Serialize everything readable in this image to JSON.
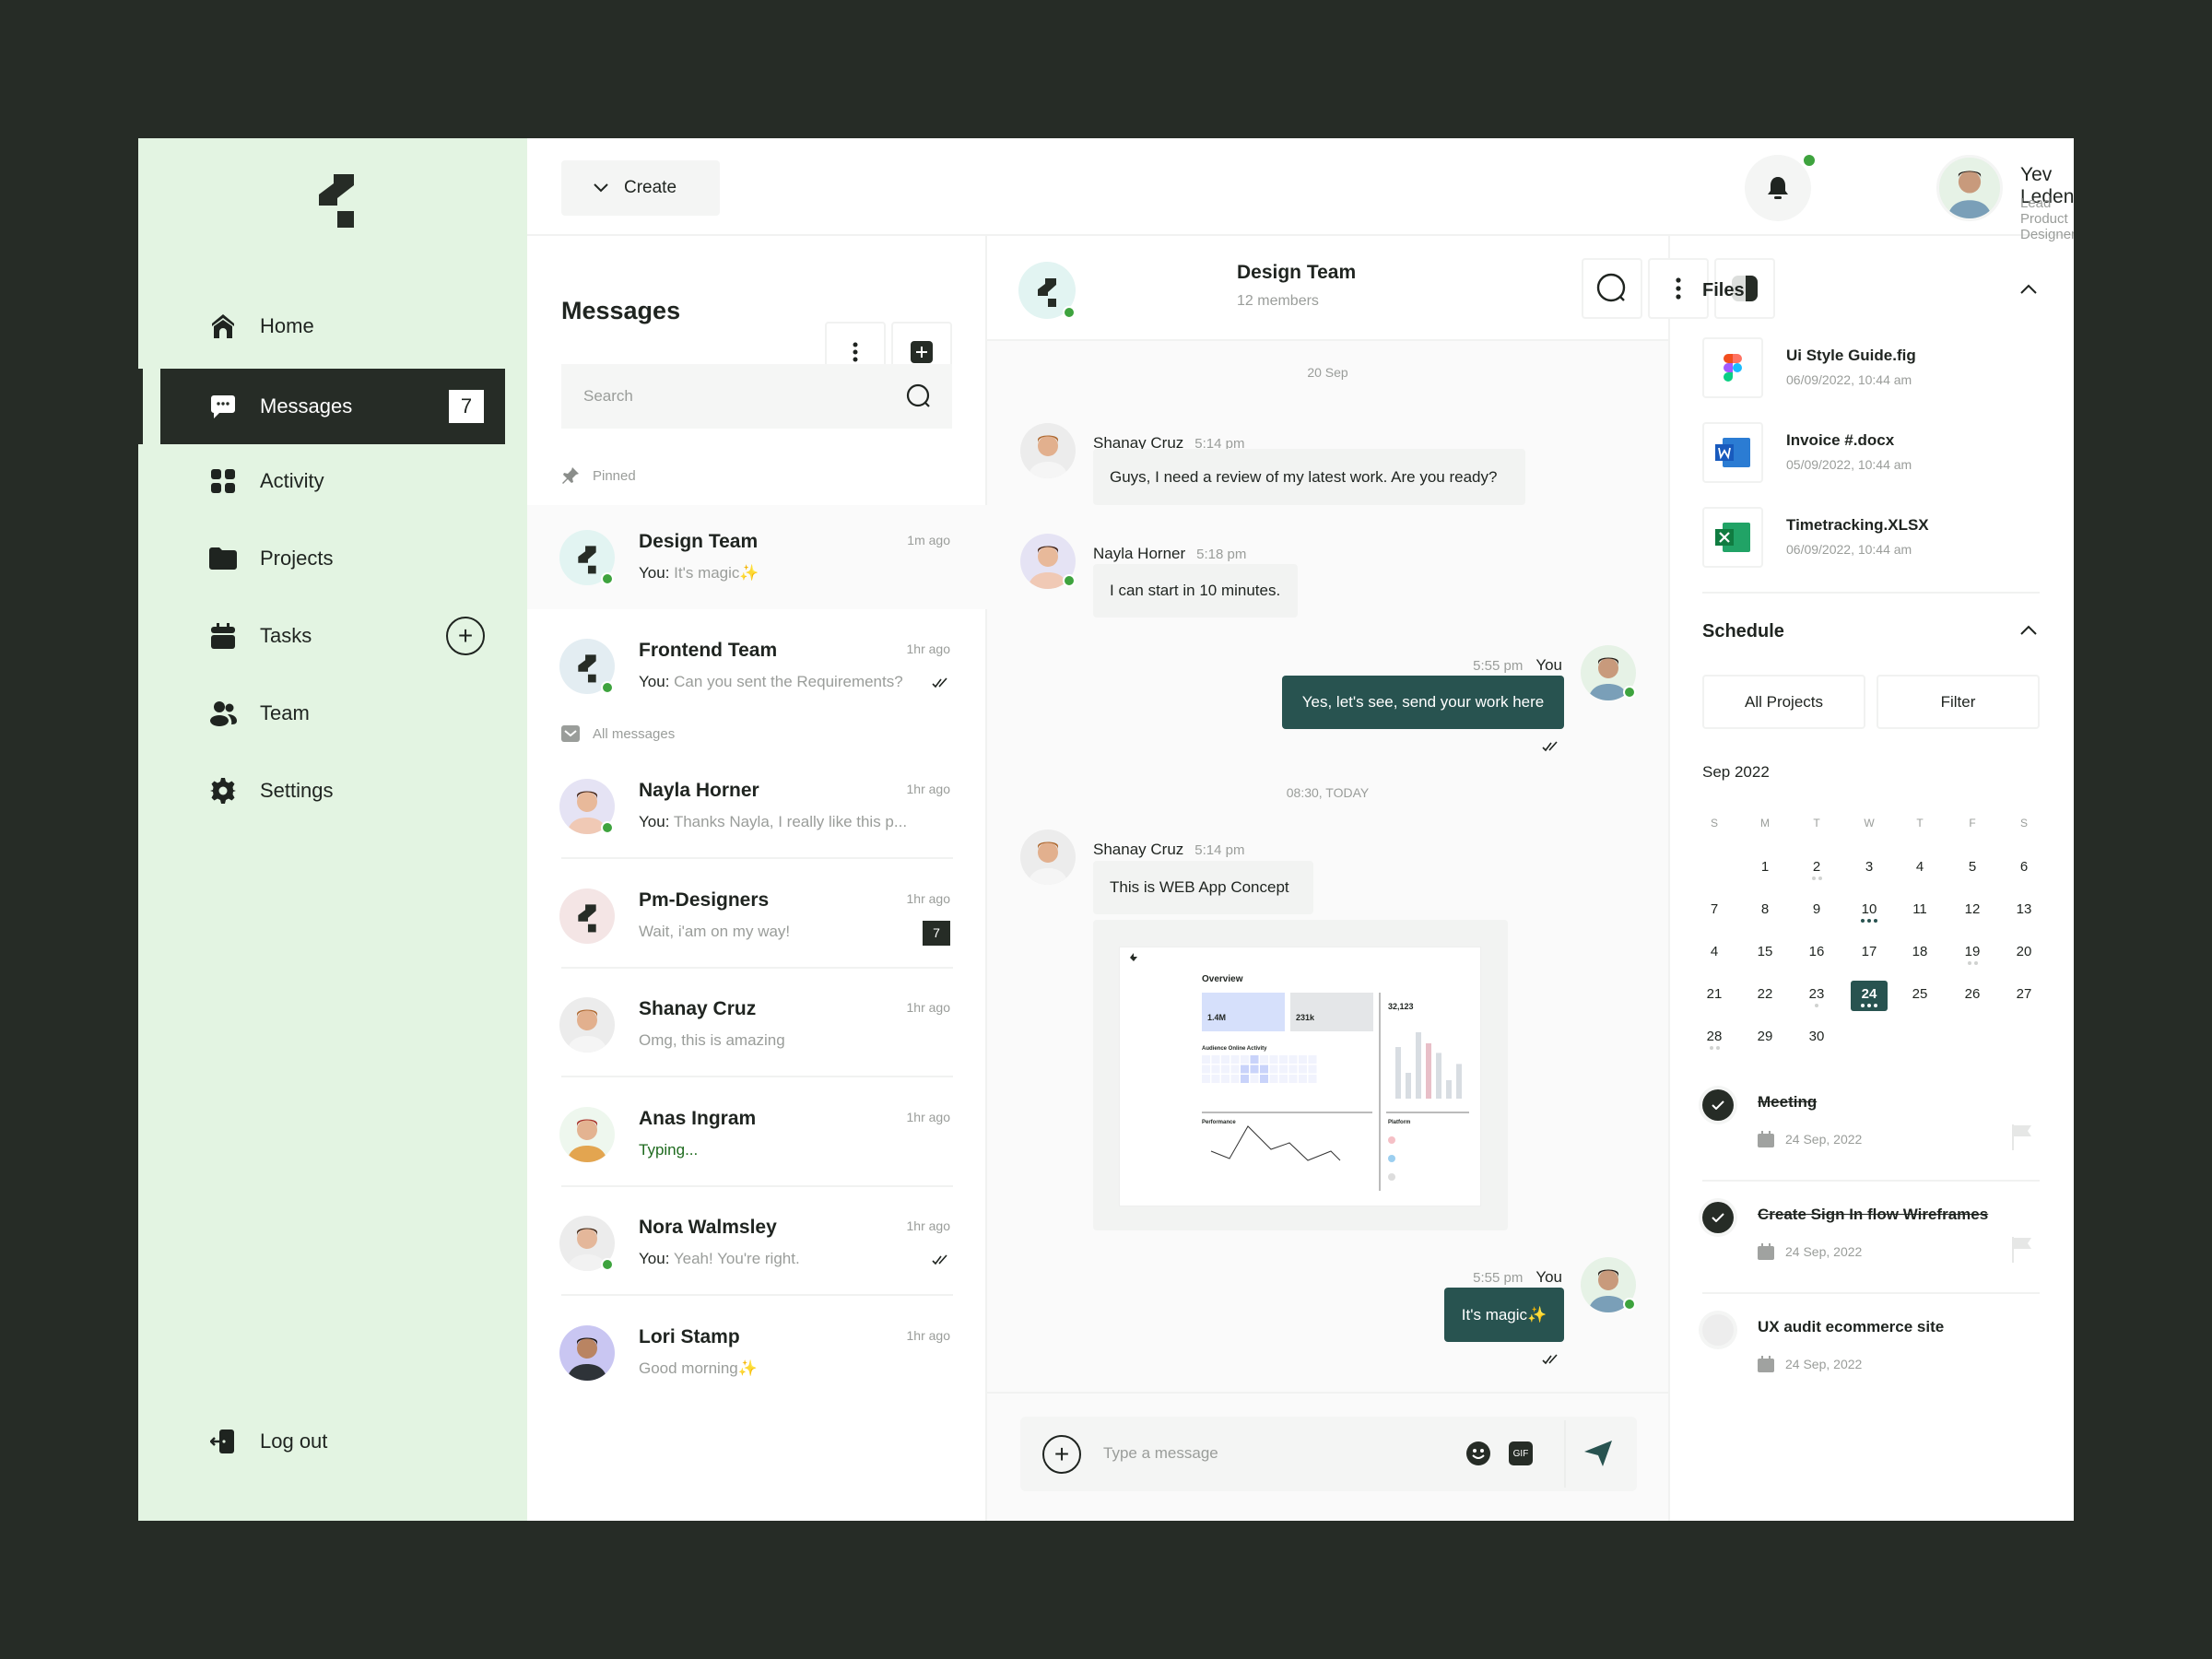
{
  "brand": {
    "logo": "brand-logo-mark"
  },
  "colors": {
    "sidebar_bg": "#e3f4e2",
    "dark": "#262c26",
    "accent": "#285350",
    "online": "#3ea33e",
    "frame_bg": "#262c26"
  },
  "sidebar": {
    "items": [
      {
        "label": "Home",
        "icon": "home-icon"
      },
      {
        "label": "Messages",
        "icon": "chat-bubble-icon",
        "badge": "7",
        "active": true
      },
      {
        "label": "Activity",
        "icon": "grid-icon"
      },
      {
        "label": "Projects",
        "icon": "folder-icon"
      },
      {
        "label": "Tasks",
        "icon": "calendar-icon"
      },
      {
        "label": "Team",
        "icon": "team-icon"
      },
      {
        "label": "Settings",
        "icon": "gear-icon"
      }
    ],
    "logout": "Log out"
  },
  "topbar": {
    "create_label": "Create",
    "user": {
      "name": "Yev Ledenov",
      "role": "Lead Product Designer"
    }
  },
  "messages": {
    "title": "Messages",
    "search_placeholder": "Search",
    "pinned_label": "Pinned",
    "all_label": "All messages",
    "pinned": [
      {
        "name": "Design Team",
        "you": "You:",
        "preview": "It's magic✨",
        "time": "1m ago",
        "group": true,
        "online": true,
        "avatar_bg": "#e2f4f2",
        "selected": true
      },
      {
        "name": "Frontend Team",
        "you": "You:",
        "preview": "Can you sent the Requirements?",
        "time": "1hr ago",
        "group": true,
        "online": true,
        "avatar_bg": "#e3edf2",
        "read": true
      }
    ],
    "all": [
      {
        "name": "Nayla Horner",
        "you": "You:",
        "preview": "Thanks Nayla, I really like this p...",
        "time": "1hr ago",
        "online": true,
        "avatar_bg": "#e5e3f4"
      },
      {
        "name": "Pm-Designers",
        "preview": "Wait, i'am on my way!",
        "time": "1hr ago",
        "group": true,
        "avatar_bg": "#f4e5e5",
        "badge": "7"
      },
      {
        "name": "Shanay Cruz",
        "preview": "Omg, this is amazing",
        "time": "1hr ago",
        "avatar_bg": "#ececec"
      },
      {
        "name": "Anas Ingram",
        "preview": "Typing...",
        "time": "1hr ago",
        "typing": true,
        "avatar_bg": "#eef7ee"
      },
      {
        "name": "Nora Walmsley",
        "you": "You:",
        "preview": "Yeah! You're right.",
        "time": "1hr ago",
        "online": true,
        "avatar_bg": "#ececec",
        "read": true
      },
      {
        "name": "Lori Stamp",
        "preview": "Good morning✨",
        "time": "1hr ago",
        "avatar_bg": "#c9c6f2"
      }
    ]
  },
  "chat": {
    "title": "Design Team",
    "subtitle": "12 members",
    "date1": "20 Sep",
    "date2": "08:30, TODAY",
    "msgs": [
      {
        "sender": "Shanay Cruz",
        "time": "5:14 pm",
        "text": "Guys, I need a review of my latest work. Are you ready?"
      },
      {
        "sender": "Nayla Horner",
        "time": "5:18 pm",
        "text": "I can start in 10 minutes."
      },
      {
        "sender": "You",
        "time": "5:55 pm",
        "text": "Yes, let's see, send your work here"
      },
      {
        "sender": "Shanay Cruz",
        "time": "5:14 pm",
        "text": "This is WEB App Concept"
      },
      {
        "sender": "You",
        "time": "5:55 pm",
        "text": "It's magic✨"
      }
    ],
    "attachment": {
      "overview": "Overview",
      "audience": "1.4M",
      "impressions": "231k",
      "users": "32,123",
      "activity": "Audience Online Activity",
      "performance": "Performance",
      "platform": "Platform",
      "bars": [
        70,
        35,
        90,
        75,
        62,
        25,
        47
      ]
    },
    "composer_placeholder": "Type a message",
    "gif_label": "GIF"
  },
  "files": {
    "title": "Files",
    "items": [
      {
        "name": "Ui Style Guide.fig",
        "date": "06/09/2022, 10:44 am",
        "icon": "figma-icon"
      },
      {
        "name": "Invoice #.docx",
        "date": "05/09/2022, 10:44 am",
        "icon": "word-icon"
      },
      {
        "name": "Timetracking.XLSX",
        "date": "06/09/2022, 10:44 am",
        "icon": "excel-icon"
      }
    ]
  },
  "schedule": {
    "title": "Schedule",
    "all_projects": "All Projects",
    "filter": "Filter",
    "month": "Sep 2022",
    "weekdays": [
      "S",
      "M",
      "T",
      "W",
      "T",
      "F",
      "S"
    ],
    "weeks": [
      [
        "",
        "1",
        "2",
        "3",
        "4",
        "5",
        "6"
      ],
      [
        "7",
        "8",
        "9",
        "10",
        "11",
        "12",
        "13"
      ],
      [
        "4",
        "15",
        "16",
        "17",
        "18",
        "19",
        "20"
      ],
      [
        "21",
        "22",
        "23",
        "24",
        "25",
        "26",
        "27"
      ],
      [
        "28",
        "29",
        "30",
        "",
        "",
        "",
        ""
      ]
    ],
    "selected": "24",
    "event_dots": {
      "2": 2,
      "10": 3,
      "19": 2,
      "23": 1,
      "24": 3,
      "28": 2
    },
    "tasks": [
      {
        "title": "Meeting",
        "date": "24 Sep, 2022",
        "done": true
      },
      {
        "title": "Create Sign In flow Wireframes",
        "date": "24 Sep, 2022",
        "done": true
      },
      {
        "title": "UX audit ecommerce site",
        "date": "24 Sep, 2022",
        "done": false
      }
    ]
  }
}
